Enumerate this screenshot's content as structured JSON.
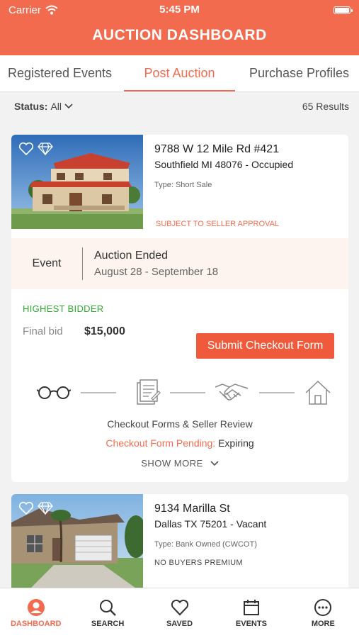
{
  "status_bar": {
    "carrier": "Carrier",
    "time": "5:45 PM"
  },
  "header": {
    "title": "AUCTION DASHBOARD"
  },
  "tabs": [
    {
      "label": "Registered Events"
    },
    {
      "label": "Post Auction"
    },
    {
      "label": "Purchase Profiles"
    }
  ],
  "filter": {
    "label": "Status:",
    "value": "All",
    "results": "65 Results"
  },
  "listings": [
    {
      "address_line1": "9788 W 12 Mile Rd #421",
      "address_line2": "Southfield MI 48076 - Occupied",
      "type": "Type: Short Sale",
      "note": "SUBJECT TO SELLER APPROVAL",
      "event_label": "Event",
      "event_status": "Auction Ended",
      "event_dates": "August 28 - September 18",
      "bid_status": "HIGHEST BIDDER",
      "final_bid_label": "Final bid",
      "final_bid_value": "$15,000",
      "checkout_button": "Submit Checkout Form",
      "step_caption": "Checkout Forms & Seller Review",
      "pending_label": "Checkout Form Pending:",
      "pending_value": "Expiring",
      "show_more": "SHOW MORE"
    },
    {
      "address_line1": "9134 Marilla St",
      "address_line2": "Dallas TX 75201 - Vacant",
      "type": "Type: Bank Owned (CWCOT)",
      "note": "NO BUYERS PREMIUM"
    }
  ],
  "nav": [
    {
      "label": "DASHBOARD",
      "icon": "user-circle-icon"
    },
    {
      "label": "SEARCH",
      "icon": "search-icon"
    },
    {
      "label": "SAVED",
      "icon": "heart-icon"
    },
    {
      "label": "EVENTS",
      "icon": "calendar-icon"
    },
    {
      "label": "MORE",
      "icon": "more-icon"
    }
  ],
  "colors": {
    "brand": "#f26b4f",
    "button": "#ef5a3c",
    "success": "#2eaa2e"
  }
}
